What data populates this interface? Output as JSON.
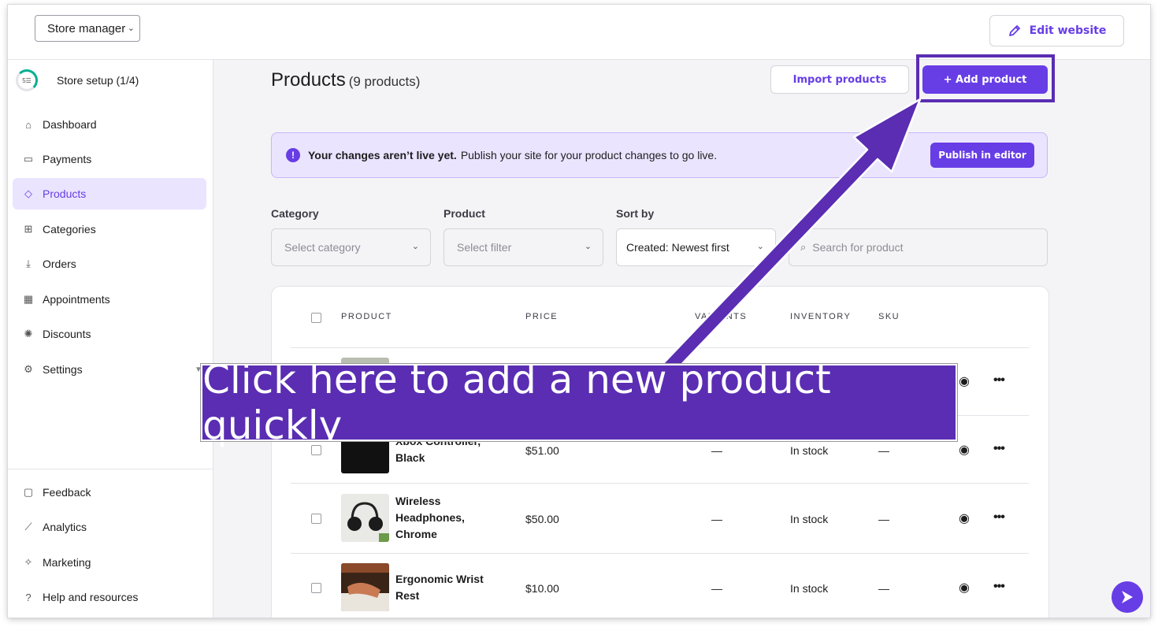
{
  "topbar": {
    "store_select": "Store manager",
    "edit_website": "Edit website"
  },
  "sidebar": {
    "setup": {
      "ring_text": "5☰",
      "label": "Store setup (1/4)"
    },
    "items": [
      {
        "label": "Dashboard",
        "icon": "home-icon"
      },
      {
        "label": "Payments",
        "icon": "card-icon"
      },
      {
        "label": "Products",
        "icon": "tag-icon",
        "active": true
      },
      {
        "label": "Categories",
        "icon": "grid-icon"
      },
      {
        "label": "Orders",
        "icon": "download-icon"
      },
      {
        "label": "Appointments",
        "icon": "calendar-icon"
      },
      {
        "label": "Discounts",
        "icon": "discount-icon"
      },
      {
        "label": "Settings",
        "icon": "gear-icon"
      }
    ],
    "bottom_items": [
      {
        "label": "Feedback",
        "icon": "chat-icon"
      },
      {
        "label": "Analytics",
        "icon": "chart-icon"
      },
      {
        "label": "Marketing",
        "icon": "sparkle-icon"
      },
      {
        "label": "Help and resources",
        "icon": "help-icon"
      }
    ]
  },
  "header": {
    "title": "Products",
    "count": "(9 products)",
    "import_label": "Import products",
    "add_label": "+ Add product"
  },
  "banner": {
    "bold": "Your changes aren’t live yet.",
    "text": "Publish your site for your product changes to go live.",
    "button": "Publish in editor"
  },
  "filters": {
    "category": {
      "label": "Category",
      "placeholder": "Select category"
    },
    "product": {
      "label": "Product",
      "placeholder": "Select filter"
    },
    "sort": {
      "label": "Sort by",
      "value": "Created:  Newest first"
    },
    "search": {
      "placeholder": "Search for product"
    }
  },
  "table": {
    "columns": [
      "PRODUCT",
      "PRICE",
      "VARIANTS",
      "INVENTORY",
      "SKU"
    ],
    "rows": [
      {
        "name": "",
        "price": "",
        "variants": "",
        "inventory": "",
        "sku": ""
      },
      {
        "name": "Xbox Controller, Black",
        "name_line1": "Xbox Controller,",
        "name_line2": "Black",
        "price": "$51.00",
        "variants": "—",
        "inventory": "In stock",
        "sku": "—"
      },
      {
        "name": "Wireless Headphones, Chrome",
        "name_line1": "Wireless",
        "name_line2": "Headphones,",
        "name_line3": "Chrome",
        "price": "$50.00",
        "variants": "—",
        "inventory": "In stock",
        "sku": "—"
      },
      {
        "name": "Ergonomic Wrist Rest",
        "name_line1": "Ergonomic Wrist",
        "name_line2": "Rest",
        "price": "$10.00",
        "variants": "—",
        "inventory": "In stock",
        "sku": "—"
      }
    ]
  },
  "callout": {
    "text": "Click here to add a new product quickly"
  },
  "colors": {
    "accent": "#673de6",
    "callout": "#5a2db3",
    "banner_bg": "#ebe4ff"
  }
}
